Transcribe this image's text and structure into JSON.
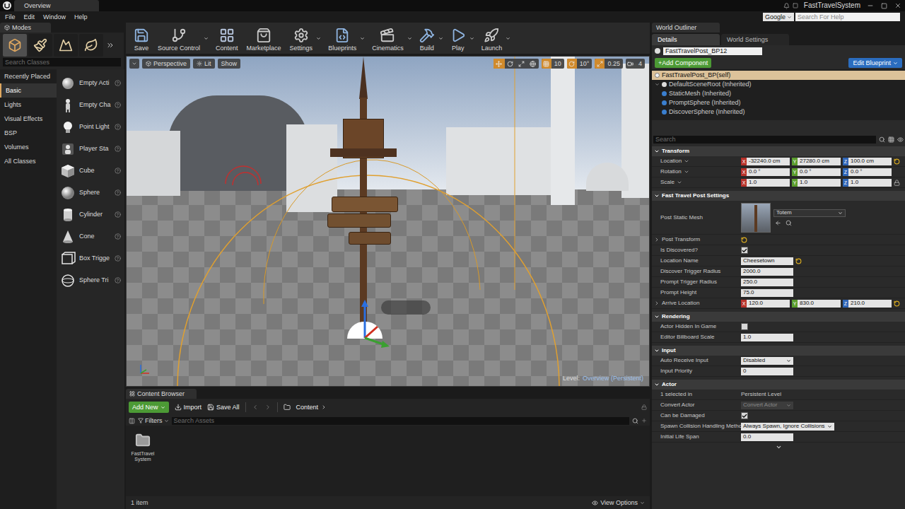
{
  "title_bar": {
    "tab": "Overview",
    "project": "FastTravelSystem"
  },
  "menu": [
    "File",
    "Edit",
    "Window",
    "Help"
  ],
  "help_search": {
    "engine": "Google",
    "placeholder": "Search For Help"
  },
  "modes": {
    "tab": "Modes",
    "search_placeholder": "Search Classes",
    "mode_buttons": [
      {
        "kind": "place",
        "selected": true
      },
      {
        "kind": "paint",
        "selected": false
      },
      {
        "kind": "landscape",
        "selected": false
      },
      {
        "kind": "foliage",
        "selected": false
      }
    ],
    "categories": [
      {
        "label": "Recently Placed",
        "selected": false
      },
      {
        "label": "Basic",
        "selected": true
      },
      {
        "label": "Lights",
        "selected": false
      },
      {
        "label": "Visual Effects",
        "selected": false
      },
      {
        "label": "BSP",
        "selected": false
      },
      {
        "label": "Volumes",
        "selected": false
      },
      {
        "label": "All Classes",
        "selected": false
      }
    ],
    "items": [
      {
        "label": "Empty Acti",
        "kind": "empty"
      },
      {
        "label": "Empty Cha",
        "kind": "character"
      },
      {
        "label": "Point Light",
        "kind": "light"
      },
      {
        "label": "Player Sta",
        "kind": "start"
      },
      {
        "label": "Cube",
        "kind": "cube"
      },
      {
        "label": "Sphere",
        "kind": "sphere"
      },
      {
        "label": "Cylinder",
        "kind": "cylinder"
      },
      {
        "label": "Cone",
        "kind": "cone"
      },
      {
        "label": "Box Trigge",
        "kind": "box-trigger"
      },
      {
        "label": "Sphere Tri",
        "kind": "sphere-trigger"
      }
    ]
  },
  "toolbar": [
    {
      "label": "Save",
      "kind": "save",
      "dropdown": false
    },
    {
      "label": "Source Control",
      "kind": "source-control",
      "dropdown": true
    },
    {
      "label": "Content",
      "kind": "content",
      "dropdown": false
    },
    {
      "label": "Marketplace",
      "kind": "marketplace",
      "dropdown": false
    },
    {
      "label": "Settings",
      "kind": "settings",
      "dropdown": true
    },
    {
      "label": "Blueprints",
      "kind": "blueprints",
      "dropdown": true
    },
    {
      "label": "Cinematics",
      "kind": "cinematics",
      "dropdown": true
    },
    {
      "label": "Build",
      "kind": "build",
      "dropdown": true
    },
    {
      "label": "Play",
      "kind": "play",
      "dropdown": true
    },
    {
      "label": "Launch",
      "kind": "launch",
      "dropdown": true
    }
  ],
  "viewport": {
    "view": "Perspective",
    "lighting": "Lit",
    "show": "Show",
    "transform_tools": [
      {
        "kind": "translate",
        "selected": true
      },
      {
        "kind": "rotate",
        "selected": false
      },
      {
        "kind": "scale",
        "selected": false
      },
      {
        "kind": "world",
        "selected": false
      }
    ],
    "snaps": [
      {
        "kind": "grid",
        "value": "10",
        "active": true
      },
      {
        "kind": "rotation",
        "value": "10°",
        "active": true
      },
      {
        "kind": "scale",
        "value": "0.25",
        "active": true
      },
      {
        "kind": "speed",
        "value": "4",
        "active": false
      }
    ],
    "level_label": "Level:",
    "level_name": "Overview (Persistent)"
  },
  "content_browser": {
    "tab": "Content Browser",
    "add_new": "Add New",
    "import": "Import",
    "save_all": "Save All",
    "path": "Content",
    "filters": "Filters",
    "search_placeholder": "Search Assets",
    "folders": [
      {
        "label": "FastTravel System"
      }
    ],
    "item_count": "1 item",
    "view_options": "View Options"
  },
  "details": {
    "outliner_tab": "World Outliner",
    "tabs": [
      {
        "label": "Details",
        "selected": true
      },
      {
        "label": "World Settings",
        "selected": false
      }
    ],
    "actor_name": "FastTravelPost_BP12",
    "add_component": "+Add Component",
    "edit_blueprint": "Edit Blueprint",
    "components": [
      {
        "label": "FastTravelPost_BP(self)",
        "kind": "self",
        "selected": true
      },
      {
        "label": "DefaultSceneRoot (Inherited)",
        "kind": "root",
        "selected": false
      },
      {
        "label": "StaticMesh (Inherited)",
        "kind": "child",
        "selected": false
      },
      {
        "label": "PromptSphere (Inherited)",
        "kind": "child",
        "selected": false
      },
      {
        "label": "DiscoverSphere (Inherited)",
        "kind": "child",
        "selected": false
      }
    ],
    "search_placeholder": "Search",
    "sections": [
      {
        "title": "Transform",
        "rows": [
          {
            "kind": "vector",
            "label": "Location",
            "menu": true,
            "reset": true,
            "lock": false,
            "expandable": false,
            "values": [
              {
                "axis": "X",
                "value": "-32240.0 cm",
                "color": "#b8322a"
              },
              {
                "axis": "Y",
                "value": "27280.0 cm",
                "color": "#5c9e2e"
              },
              {
                "axis": "Z",
                "value": "100.0 cm",
                "color": "#2f66b8"
              }
            ]
          },
          {
            "kind": "vector",
            "label": "Rotation",
            "menu": true,
            "reset": false,
            "lock": false,
            "expandable": false,
            "values": [
              {
                "axis": "X",
                "value": "0.0 °",
                "color": "#b8322a"
              },
              {
                "axis": "Y",
                "value": "0.0 °",
                "color": "#5c9e2e"
              },
              {
                "axis": "Z",
                "value": "0.0 °",
                "color": "#2f66b8"
              }
            ]
          },
          {
            "kind": "vector",
            "label": "Scale",
            "menu": true,
            "reset": false,
            "lock": true,
            "expandable": false,
            "values": [
              {
                "axis": "X",
                "value": "1.0",
                "color": "#b8322a"
              },
              {
                "axis": "Y",
                "value": "1.0",
                "color": "#5c9e2e"
              },
              {
                "axis": "Z",
                "value": "1.0",
                "color": "#2f66b8"
              }
            ]
          }
        ]
      },
      {
        "title": "Fast Travel Post Settings",
        "rows": [
          {
            "kind": "mesh",
            "label": "Post Static Mesh",
            "value": "Totem"
          },
          {
            "kind": "expander",
            "label": "Post Transform",
            "reset": true
          },
          {
            "kind": "check",
            "label": "Is Discovered?",
            "checked": true
          },
          {
            "kind": "text",
            "label": "Location Name",
            "value": "Cheesetown",
            "reset": true
          },
          {
            "kind": "number",
            "label": "Discover Trigger Radius",
            "value": "2000.0"
          },
          {
            "kind": "number",
            "label": "Prompt Trigger Radius",
            "value": "250.0"
          },
          {
            "kind": "number",
            "label": "Prompt Height",
            "value": "75.0"
          },
          {
            "kind": "vector",
            "label": "Arrive Location",
            "menu": false,
            "reset": true,
            "lock": false,
            "expandable": true,
            "values": [
              {
                "axis": "X",
                "value": "120.0",
                "color": "#b8322a"
              },
              {
                "axis": "Y",
                "value": "830.0",
                "color": "#5c9e2e"
              },
              {
                "axis": "Z",
                "value": "210.0",
                "color": "#2f66b8"
              }
            ]
          }
        ]
      },
      {
        "title": "Rendering",
        "rows": [
          {
            "kind": "check",
            "label": "Actor Hidden In Game",
            "checked": false
          },
          {
            "kind": "number",
            "label": "Editor Billboard Scale",
            "value": "1.0"
          }
        ]
      },
      {
        "title": "Input",
        "rows": [
          {
            "kind": "dropdown",
            "label": "Auto Receive Input",
            "value": "Disabled",
            "disabled": false
          },
          {
            "kind": "number",
            "label": "Input Priority",
            "value": "0"
          }
        ]
      },
      {
        "title": "Actor",
        "rows": [
          {
            "kind": "readonly",
            "label": "1 selected in",
            "value": "Persistent Level"
          },
          {
            "kind": "dropdown",
            "label": "Convert Actor",
            "value": "Convert Actor",
            "disabled": true
          },
          {
            "kind": "check",
            "label": "Can be Damaged",
            "checked": true
          },
          {
            "kind": "dropdown",
            "label": "Spawn Collision Handling Metho",
            "value": "Always Spawn, Ignore Collisions",
            "disabled": false
          },
          {
            "kind": "number",
            "label": "Initial Life Span",
            "value": "0.0"
          }
        ]
      }
    ]
  }
}
